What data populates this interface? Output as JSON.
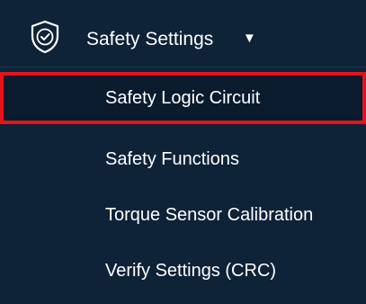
{
  "menu": {
    "header": {
      "icon": "shield-check-icon",
      "label": "Safety Settings",
      "caret": "▼"
    },
    "items": [
      {
        "label": "Safety Logic Circuit",
        "highlighted": true
      },
      {
        "label": "Safety Functions",
        "highlighted": false
      },
      {
        "label": "Torque Sensor Calibration",
        "highlighted": false
      },
      {
        "label": "Verify Settings (CRC)",
        "highlighted": false
      }
    ]
  },
  "colors": {
    "background": "#0e2238",
    "text": "#ffffff",
    "highlight_border": "#e3141c"
  }
}
